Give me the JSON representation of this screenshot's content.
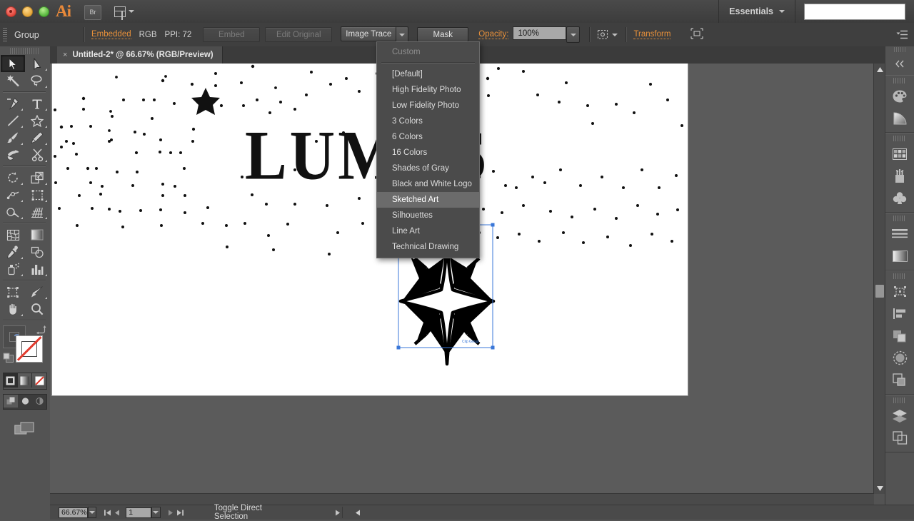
{
  "titlebar": {
    "app_icon": "Ai",
    "bridge_button": "Br",
    "workspace_label": "Essentials",
    "traffic_lights": [
      "close-red",
      "minimize-yellow",
      "zoom-green"
    ],
    "search_value": ""
  },
  "control_bar": {
    "selection_label": "Group",
    "embedded_label": "Embedded",
    "color_mode": "RGB",
    "ppi_label": "PPI: 72",
    "embed_button": "Embed",
    "edit_original_button": "Edit Original",
    "image_trace_button": "Image Trace",
    "mask_button": "Mask",
    "opacity_label": "Opacity:",
    "opacity_value": "100%",
    "transform_link": "Transform",
    "accent_color": "#e8903a"
  },
  "document": {
    "tab_title": "Untitled-2* @ 66.67% (RGB/Preview)",
    "close_glyph": "×"
  },
  "trace_menu": {
    "visible": true,
    "items": [
      {
        "label": "Custom",
        "state": "disabled"
      },
      {
        "label": "[Default]",
        "state": "normal"
      },
      {
        "label": "High Fidelity Photo",
        "state": "normal"
      },
      {
        "label": "Low Fidelity Photo",
        "state": "normal"
      },
      {
        "label": "3 Colors",
        "state": "normal"
      },
      {
        "label": "6 Colors",
        "state": "normal"
      },
      {
        "label": "16 Colors",
        "state": "normal"
      },
      {
        "label": "Shades of Gray",
        "state": "normal"
      },
      {
        "label": "Black and White Logo",
        "state": "normal"
      },
      {
        "label": "Sketched Art",
        "state": "highlighted"
      },
      {
        "label": "Silhouettes",
        "state": "normal"
      },
      {
        "label": "Line Art",
        "state": "normal"
      },
      {
        "label": "Technical Drawing",
        "state": "normal"
      }
    ]
  },
  "artwork": {
    "headline_text": "LUMOS",
    "star_count": 1,
    "selection_color": "#3a77d8"
  },
  "toolbar": {
    "tools": [
      "selection-tool",
      "direct-selection-tool",
      "magic-wand-tool",
      "lasso-tool",
      "pen-tool",
      "type-tool",
      "line-segment-tool",
      "shape-tool",
      "paintbrush-tool",
      "pencil-tool",
      "blob-brush-tool",
      "scissors-tool",
      "rotate-tool",
      "scale-tool",
      "width-tool",
      "free-transform-tool",
      "shape-builder-tool",
      "perspective-grid-tool",
      "mesh-tool",
      "gradient-tool",
      "eyedropper-tool",
      "blend-tool",
      "symbol-sprayer-tool",
      "column-graph-tool",
      "artboard-tool",
      "slice-tool",
      "hand-tool",
      "zoom-tool"
    ],
    "fill_color": "#ffffff",
    "stroke_color": "none",
    "none_indicator_color": "#e23b2e",
    "color_modes": [
      "color-swatch",
      "gradient-swatch",
      "none-swatch"
    ],
    "draw_modes": [
      "draw-normal",
      "draw-behind",
      "draw-inside"
    ],
    "screen_mode": "change-screen-mode"
  },
  "dock": {
    "groups": [
      {
        "icons": [
          "color-panel",
          "color-guide-panel"
        ]
      },
      {
        "icons": [
          "swatches-panel",
          "brushes-panel",
          "symbols-panel"
        ]
      },
      {
        "icons": [
          "stroke-panel",
          "gradient-panel"
        ]
      },
      {
        "icons": [
          "transform-panel",
          "align-panel",
          "pathfinder-panel",
          "transparency-panel",
          "appearance-panel"
        ]
      },
      {
        "icons": [
          "layers-panel",
          "artboards-panel"
        ]
      }
    ]
  },
  "status_bar": {
    "zoom_value": "66.67%",
    "page_value": "1",
    "status_text": "Toggle Direct Selection"
  }
}
